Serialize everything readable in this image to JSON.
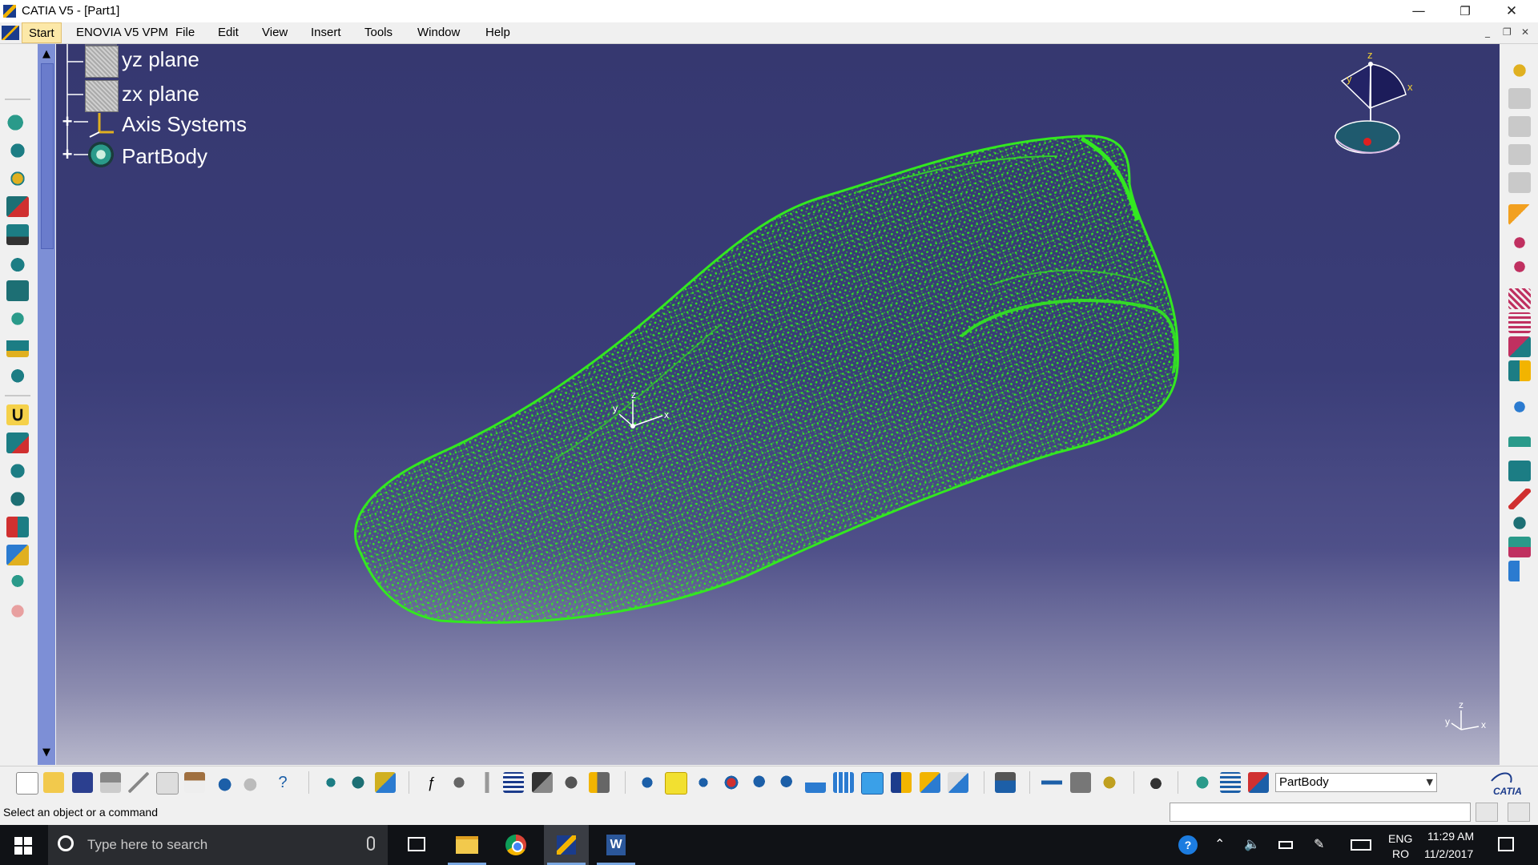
{
  "window": {
    "title": "CATIA V5 - [Part1]",
    "controls": {
      "minimize": "—",
      "restore": "❐",
      "close": "✕"
    }
  },
  "menubar": {
    "items": [
      "Start",
      "ENOVIA V5 VPM",
      "File",
      "Edit",
      "View",
      "Insert",
      "Tools",
      "Window",
      "Help"
    ],
    "mdi": {
      "minimize": "_",
      "restore": "❐",
      "close": "✕"
    }
  },
  "tree": {
    "nodes": [
      {
        "label": "yz plane",
        "icon": "plane-icon"
      },
      {
        "label": "zx plane",
        "icon": "plane-icon"
      },
      {
        "label": "Axis Systems",
        "icon": "axis-system-icon",
        "expand": "+"
      },
      {
        "label": "PartBody",
        "icon": "partbody-icon",
        "expand": "+"
      }
    ]
  },
  "viewport": {
    "model": "shoe last point cloud",
    "point_color": "#33e820",
    "compass_axes": {
      "x": "x",
      "y": "y",
      "z": "z"
    },
    "center_axes": {
      "x": "x",
      "y": "y",
      "z": "z"
    },
    "corner_axes": {
      "x": "x",
      "y": "y",
      "z": "z"
    }
  },
  "bottom_toolbar": {
    "current_body": "PartBody",
    "brand": "CATIA"
  },
  "statusbar": {
    "message": "Select an object or a command"
  },
  "taskbar": {
    "search_placeholder": "Type here to search",
    "language": "ENG",
    "layout": "RO",
    "time": "11:29 AM",
    "date": "11/2/2017"
  },
  "colors": {
    "viewport_top": "#363870",
    "viewport_bottom": "#b7b7cb",
    "scrollbar": "#7d8fd6",
    "start_highlight": "#fce8a8"
  }
}
